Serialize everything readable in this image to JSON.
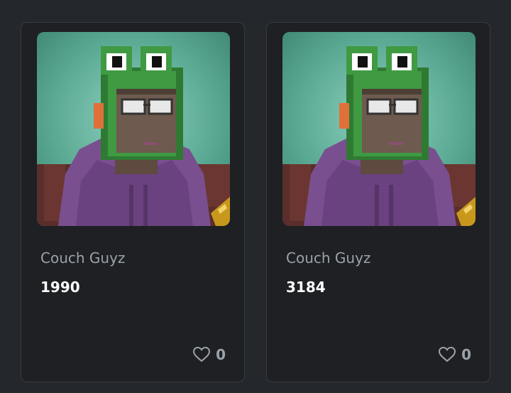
{
  "colors": {
    "page_background": "#24272b",
    "card_background": "#1e2023",
    "card_border": "#383c42",
    "muted_text": "#9ba2aa",
    "primary_text": "#ffffff"
  },
  "cards": [
    {
      "collection": "Couch Guyz",
      "token_id": "1990",
      "likes": "0",
      "image_icon": "pixel-frog-hood-guy"
    },
    {
      "collection": "Couch Guyz",
      "token_id": "3184",
      "likes": "0",
      "image_icon": "pixel-frog-hood-guy"
    }
  ]
}
